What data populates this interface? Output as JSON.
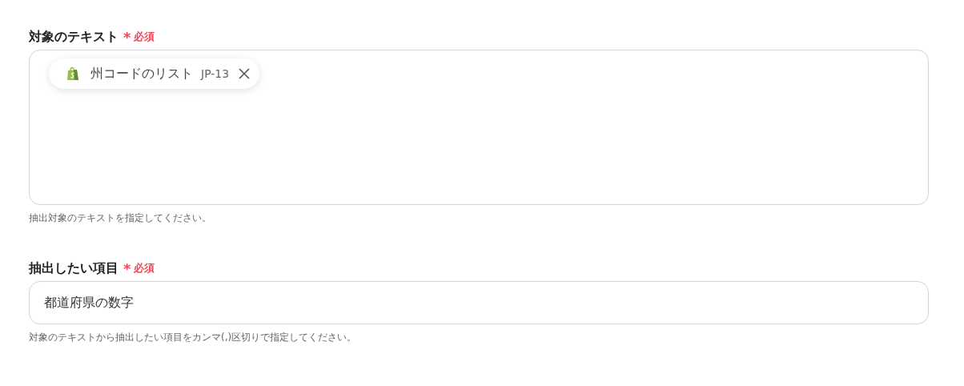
{
  "fields": [
    {
      "kind": "textarea",
      "label": "対象のテキスト",
      "required": true,
      "required_mark": "*",
      "required_text": "必須",
      "token": {
        "label": "州コードのリスト",
        "value": "JP-13"
      },
      "help": "抽出対象のテキストを指定してください。"
    },
    {
      "kind": "input",
      "label": "抽出したい項目",
      "required": true,
      "required_mark": "*",
      "required_text": "必須",
      "value": "都道府県の数字",
      "help": "対象のテキストから抽出したい項目をカンマ(,)区切りで指定してください。"
    }
  ]
}
